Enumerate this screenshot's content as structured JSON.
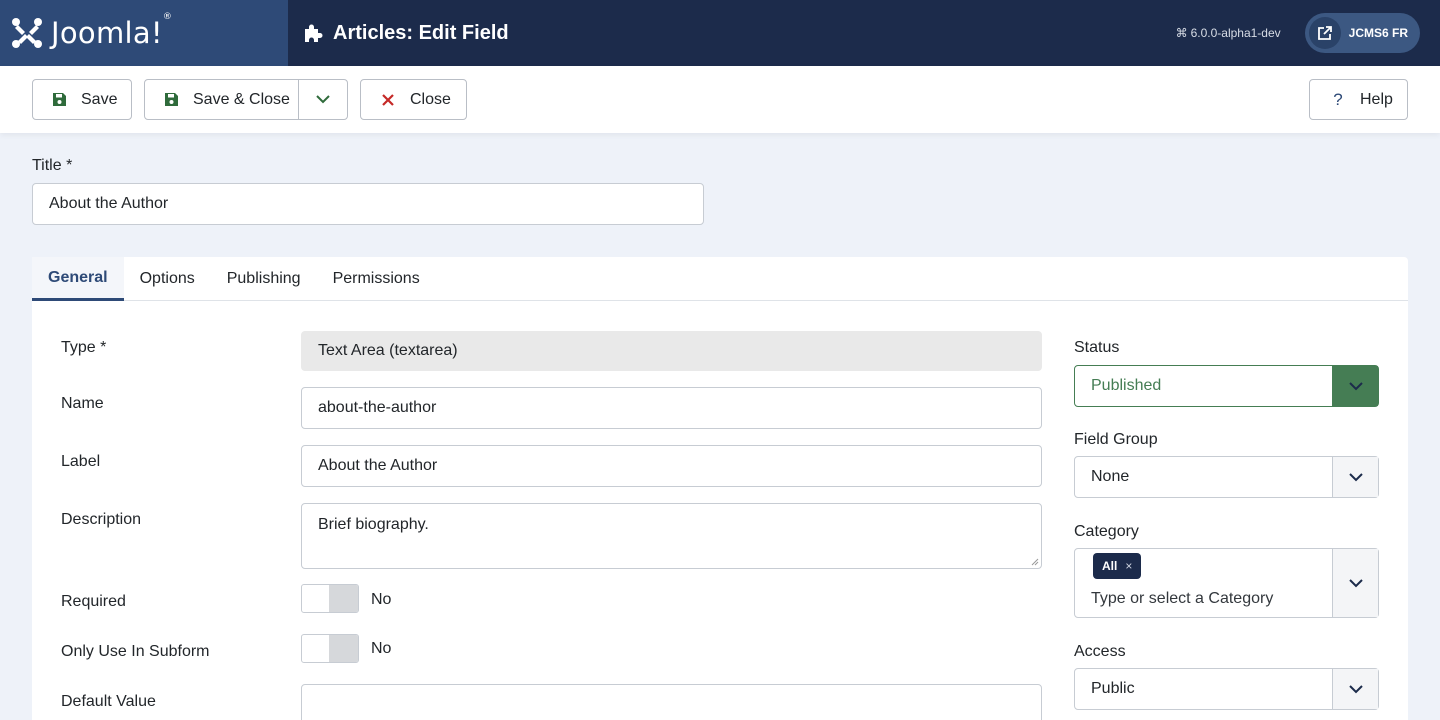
{
  "header": {
    "logo_text": "Joomla!",
    "page_title": "Articles: Edit Field",
    "version": "6.0.0-alpha1-dev",
    "site_label": "JCMS6 FR"
  },
  "toolbar": {
    "save_label": "Save",
    "save_close_label": "Save & Close",
    "close_label": "Close",
    "help_label": "Help"
  },
  "title_field": {
    "label": "Title *",
    "value": "About the Author"
  },
  "tabs": [
    {
      "label": "General",
      "active": true
    },
    {
      "label": "Options",
      "active": false
    },
    {
      "label": "Publishing",
      "active": false
    },
    {
      "label": "Permissions",
      "active": false
    }
  ],
  "general": {
    "type_label": "Type *",
    "type_value": "Text Area (textarea)",
    "name_label": "Name",
    "name_value": "about-the-author",
    "label_label": "Label",
    "label_value": "About the Author",
    "description_label": "Description",
    "description_value": "Brief biography.",
    "required_label": "Required",
    "required_value": "No",
    "subform_label": "Only Use In Subform",
    "subform_value": "No",
    "default_label": "Default Value",
    "default_value": ""
  },
  "sidebar": {
    "status_label": "Status",
    "status_value": "Published",
    "field_group_label": "Field Group",
    "field_group_value": "None",
    "category_label": "Category",
    "category_chip": "All",
    "category_chip_remove": "×",
    "category_placeholder": "Type or select a Category",
    "access_label": "Access",
    "access_value": "Public"
  },
  "colors": {
    "header_bg": "#1c2b4b",
    "logo_bg": "#2e4a77",
    "published_green": "#457d54",
    "close_red": "#c52827",
    "save_green": "#2f6b3b"
  }
}
